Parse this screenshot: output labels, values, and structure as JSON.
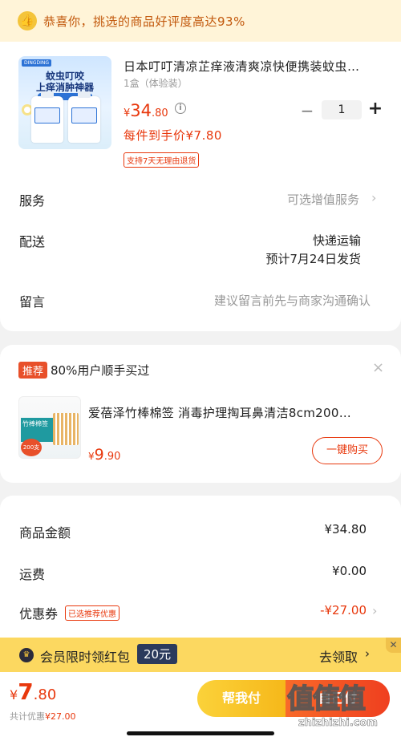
{
  "banner": {
    "text": "恭喜你，挑选的商品好评度高达93%"
  },
  "product": {
    "image_text_1": "蚊虫叮咬",
    "image_text_2": "上痒消肿神器",
    "title": "日本叮叮清凉芷痒液清爽凉快便携装蚊虫…",
    "spec": "1盒（体验装）",
    "price_currency": "¥",
    "price_int": "34",
    "price_dec": ".80",
    "qty_minus": "−",
    "quantity": "1",
    "qty_plus": "+",
    "hand_price": "每件到手价¥7.80",
    "return_tag": "支持7天无理由退货"
  },
  "rows": {
    "service_label": "服务",
    "service_value": "可选增值服务",
    "delivery_label": "配送",
    "delivery_value": "快递运输",
    "delivery_date": "预计7月24日发货",
    "message_label": "留言",
    "message_placeholder": "建议留言前先与商家沟通确认"
  },
  "recommend": {
    "badge": "推荐",
    "title": "80%用户顺手买过",
    "item_image_label": "竹棒棉签",
    "item_image_badge": "200支",
    "item_name": "爱蓓泽竹棒棉签 消毒护理掏耳鼻清洁8cm200…",
    "price_currency": "¥",
    "price_int": "9",
    "price_dec": ".90",
    "buy_button": "一键购买"
  },
  "summary": {
    "goods_label": "商品金额",
    "goods_value": "¥34.80",
    "shipping_label": "运费",
    "shipping_value": "¥0.00",
    "coupon_label": "优惠券",
    "coupon_tag": "已选推荐优惠",
    "coupon_value": "-¥27.00"
  },
  "member": {
    "text": "会员限时领红包",
    "amount": "20元",
    "action": "去领取"
  },
  "bottom": {
    "currency": "¥",
    "total_int": "7",
    "total_dec": ".80",
    "discount_label": "共计优惠",
    "discount_value": "¥27.00",
    "help_pay": "帮我付",
    "self_pay": "自己付"
  },
  "watermark": {
    "big": "值值值",
    "small": "zhizhizhi.com"
  },
  "colors": {
    "accent_red": "#e8380d",
    "banner_bg": "#fff4d8",
    "member_bg": "#fcd860"
  }
}
